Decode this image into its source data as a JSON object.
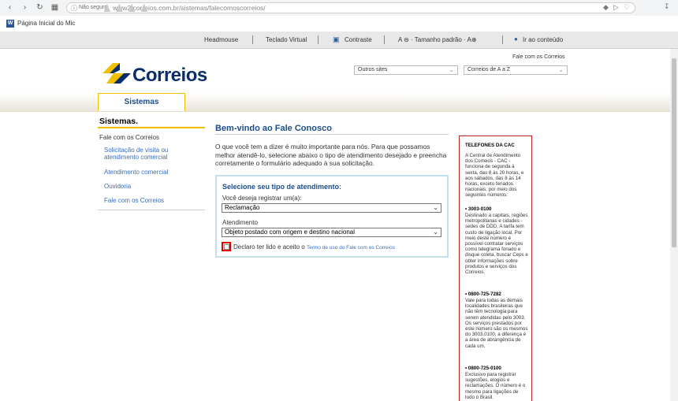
{
  "browser": {
    "url_security_label": "Não seguro",
    "url_text": "www2.correios.com.br/sistemas/falecomoscorreios/",
    "bookmark_label": "Página Inicial do Mic"
  },
  "accessibility_bar": {
    "headmouse": "Headmouse",
    "teclado": "Teclado Virtual",
    "contraste": "Contraste",
    "tamanho": "A ⊖ · Tamanho padrão · A⊕",
    "ir_conteudo": "Ir ao conteúdo"
  },
  "header": {
    "logo_text": "Correios",
    "fale_link": "Fale com os Correios",
    "outros_sites": "Outros sites",
    "correios_az": "Correios de A a Z",
    "tab": "Sistemas"
  },
  "sidebar": {
    "title": "Sistemas.",
    "subtitle": "Fale com os Correios",
    "links": [
      "Solicitação de visita ou atendimento comercial",
      "Atendimento comercial",
      "Ouvidoria",
      "Fale com os Correios"
    ]
  },
  "main": {
    "title": "Bem-vindo ao Fale Conosco",
    "intro": "O que você tem a dizer é muito importante para nós. Para que possamos melhor atendê-lo, selecione abaixo o tipo de atendimento desejado e preencha corretamente o formulário adequado à sua solicitação.",
    "form_title": "Selecione seu tipo de atendimento:",
    "registrar_label": "Você deseja registrar um(a):",
    "registrar_value": "Reclamação",
    "atendimento_label": "Atendimento",
    "atendimento_value": "Objeto postado com origem e destino nacional",
    "agree_text": "Declaro ter lido e aceito o",
    "agree_link": "Termo de uso do Fale com os Correios"
  },
  "cac": {
    "title": "TELEFONES DA CAC",
    "p1": "A Central de Atendimento dos Correios - CAC - funciona de segunda à sexta, das 8 às 20 horas, e aos sábados, das 8 às 14 horas, exceto feriados nacionais, por meio dos seguintes números:",
    "n1": "• 3003-0100",
    "p2": "Destinado a capitais, regiões metropolitanas e cidades - sedes de DDD. A tarifa tem custo de ligação local. Por meio deste número é possível contratar serviços como telegrama fonado e disque coleta, buscar Ceps e obter informações sobre produtos e serviços dos Correios.",
    "n2": "• 0800-725-7282",
    "p3": "Vale para todas as demais localidades brasileiras que não têm tecnologia para serem atendidas pelo 3003. Os serviços prestados por este número são os mesmos do 3003.0100, a diferença é a área de abrangência de cada um.",
    "n3": "• 0800-725-0100",
    "p4": "Exclusivo para registrar sugestões, elogios e reclamações. O número é o mesmo para ligações de todo o Brasil."
  },
  "colors": {
    "brand_blue": "#0b2e6b",
    "brand_yellow": "#f0c000",
    "link_blue": "#3b6db6",
    "highlight_red": "#d00000"
  }
}
